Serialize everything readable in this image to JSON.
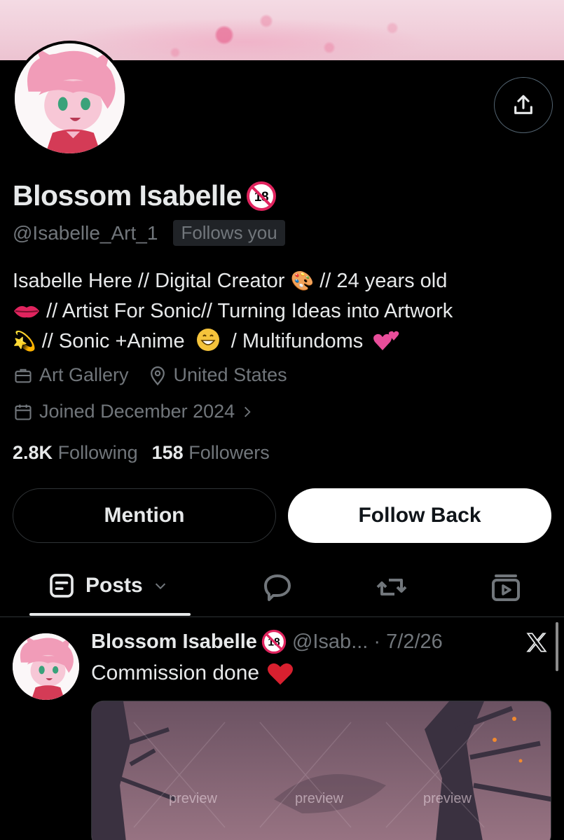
{
  "profile": {
    "display_name": "Blossom Isabelle",
    "handle": "@Isabelle_Art_1",
    "follows_you": "Follows you",
    "bio_line1": "Isabelle Here // Digital Creator",
    "bio_line1b": "// 24 years old",
    "bio_line2": "// Artist For Sonic// Turning Ideas into Artwork",
    "bio_line3a": "// Sonic +Anime",
    "bio_line3b": "/ Multifundoms",
    "category": "Art Gallery",
    "location": "United States",
    "joined": "Joined December 2024",
    "following_count": "2.8K",
    "following_label": "Following",
    "followers_count": "158",
    "followers_label": "Followers"
  },
  "buttons": {
    "mention": "Mention",
    "follow_back": "Follow Back"
  },
  "tabs": {
    "posts": "Posts"
  },
  "post": {
    "name": "Blossom Isabelle",
    "handle_date": "@Isab... · 7/2/26",
    "text": "Commission done",
    "watermarks": [
      "preview",
      "preview",
      "preview"
    ]
  },
  "colors": {
    "background": "#000000",
    "text": "#e7e9ea",
    "muted": "#71767b",
    "border": "#2f3336"
  }
}
